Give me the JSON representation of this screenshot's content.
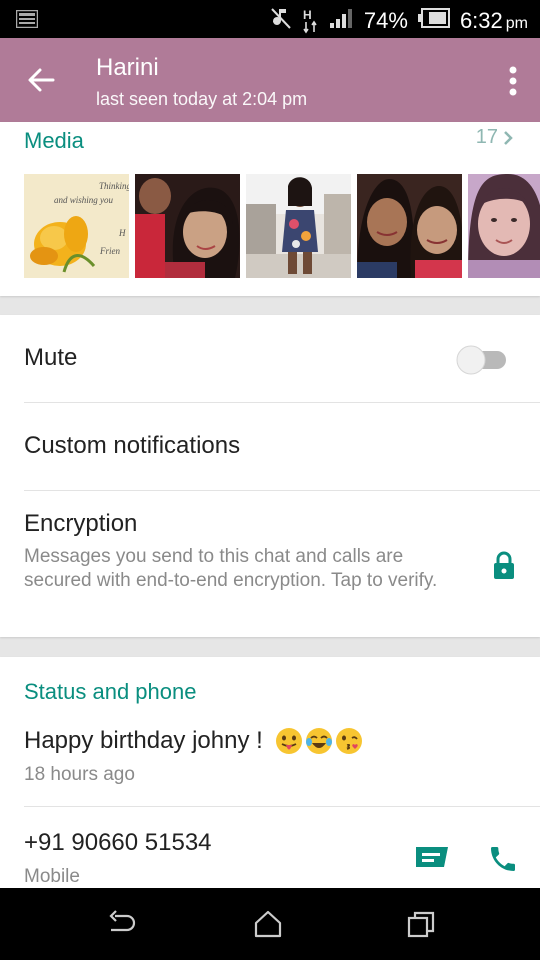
{
  "status_bar": {
    "battery": "74%",
    "time": "6:32",
    "ampm": "pm",
    "network": "H"
  },
  "header": {
    "title": "Harini",
    "subtitle": "last seen today at 2:04 pm"
  },
  "media": {
    "title": "Media",
    "count": "17",
    "thumbnails": [
      {
        "name": "greeting-card-flower",
        "lines": [
          "Thinking",
          "and wishing you",
          "H",
          "Frien"
        ]
      },
      {
        "name": "selfie-girl-smiling"
      },
      {
        "name": "girl-standing-balcony"
      },
      {
        "name": "two-girls-selfie"
      },
      {
        "name": "girl-portrait-partial"
      }
    ]
  },
  "settings": {
    "mute_label": "Mute",
    "mute_on": false,
    "custom_notifications_label": "Custom notifications",
    "encryption_label": "Encryption",
    "encryption_desc": "Messages you send to this chat and calls are secured with end-to-end encryption. Tap to verify."
  },
  "status_phone": {
    "title": "Status and phone",
    "status_text": "Happy birthday johny !",
    "status_time": "18 hours ago",
    "phone": "+91 90660 51534",
    "phone_type": "Mobile"
  },
  "colors": {
    "appbar": "#b07b98",
    "accent": "#0a8e7f"
  }
}
